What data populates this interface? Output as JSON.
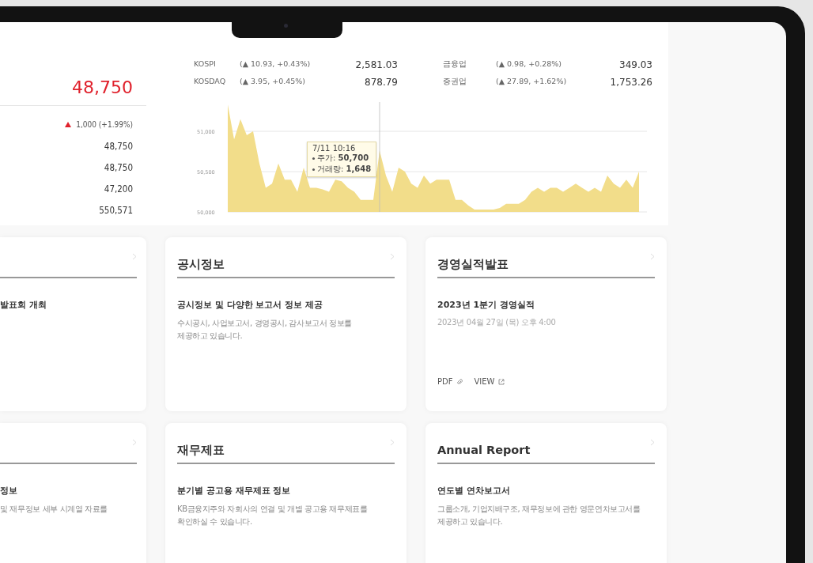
{
  "stock": {
    "price": "48,750",
    "rows": [
      {
        "kind": "change",
        "value": "1,000 (+1.99%)"
      },
      {
        "kind": "plain",
        "value": "48,750"
      },
      {
        "kind": "plain",
        "value": "48,750"
      },
      {
        "kind": "plain",
        "value": "47,200"
      },
      {
        "kind": "plain",
        "value": "550,571"
      }
    ]
  },
  "indices": [
    {
      "name": "KOSPI",
      "change": "(▲ 10.93, +0.43%)",
      "value": "2,581.03"
    },
    {
      "name": "금융업",
      "change": "(▲ 0.98, +0.28%)",
      "value": "349.03"
    },
    {
      "name": "KOSDAQ",
      "change": "(▲ 3.95, +0.45%)",
      "value": "878.79"
    },
    {
      "name": "증권업",
      "change": "(▲ 27.89, +1.62%)",
      "value": "1,753.26"
    }
  ],
  "chart": {
    "chart_data": {
      "type": "area",
      "ylim": [
        50000,
        51350
      ],
      "yticks": [
        {
          "value": 50000,
          "label": "50,000"
        },
        {
          "value": 50500,
          "label": "50,500"
        },
        {
          "value": 51000,
          "label": "51,000"
        }
      ],
      "series": [
        {
          "color": "#f2dd8a",
          "values": [
            51330,
            50900,
            51150,
            50950,
            51000,
            50600,
            50300,
            50350,
            50600,
            50400,
            50400,
            50250,
            50550,
            50300,
            50300,
            50280,
            50250,
            50400,
            50380,
            50300,
            50250,
            50150,
            50150,
            50150,
            50760,
            50450,
            50250,
            50550,
            50500,
            50350,
            50300,
            50450,
            50350,
            50400,
            50400,
            50400,
            50150,
            50150,
            50080,
            50030,
            50030,
            50030,
            50030,
            50050,
            50100,
            50100,
            50100,
            50150,
            50250,
            50300,
            50250,
            50300,
            50300,
            50250,
            50300,
            50350,
            50300,
            50250,
            50300,
            50250,
            50450,
            50350,
            50300,
            50400,
            50300,
            50500
          ]
        }
      ]
    },
    "tooltip": {
      "date": "7/11 10:16",
      "price": "주가: **50,700**",
      "volume": "거래량: **1,648**"
    }
  },
  "card_rows": [
    [
      {
        "cut": true,
        "headline": "발표회 개최"
      },
      {
        "cut": false,
        "title": "공시정보",
        "headline": "공시정보 및 다양한 보고서 정보 제공",
        "description": "수시공시, 사업보고서, 경영공시, 감사보고서 정보를\n제공하고 있습니다."
      },
      {
        "cut": false,
        "title": "경영실적발표",
        "headline": "2023년 1분기 경영실적",
        "date": "2023년 04월 27일 (목) 오후 4:00",
        "links": [
          {
            "kind": "attachment",
            "label": "PDF"
          },
          {
            "kind": "external",
            "label": "VIEW"
          }
        ]
      }
    ],
    [
      {
        "cut": true,
        "headline": "정보",
        "description": "및 재무정보 세부 시계열 자료를"
      },
      {
        "cut": false,
        "title": "재무제표",
        "headline": "분기별 공고용 재무제표 정보",
        "description": "KB금융지주와 자회사의 연결 및 개별 공고용 재무제표를\n확인하실 수 있습니다."
      },
      {
        "cut": false,
        "title": "Annual Report",
        "headline": "연도별 연차보고서",
        "description": "그룹소개, 기업지배구조, 재무정보에 관한 영문연차보고서를\n제공하고 있습니다."
      }
    ]
  ]
}
